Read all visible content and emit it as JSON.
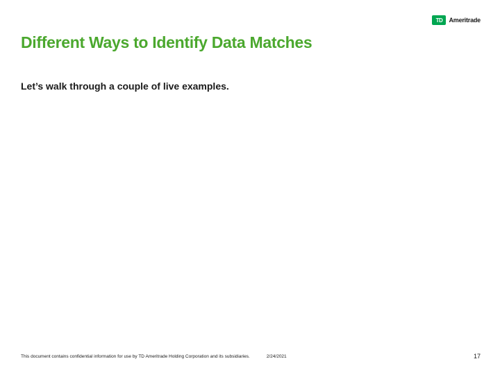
{
  "logo": {
    "mark": "TD",
    "word": "Ameritrade"
  },
  "title": "Different Ways to Identify Data Matches",
  "body": "Let’s walk through a couple of live examples.",
  "footer": {
    "confidential": "This document contains confidential information for use by TD Ameritrade Holding Corporation and its subsidiaries.",
    "date": "2/24/2021",
    "page": "17"
  }
}
